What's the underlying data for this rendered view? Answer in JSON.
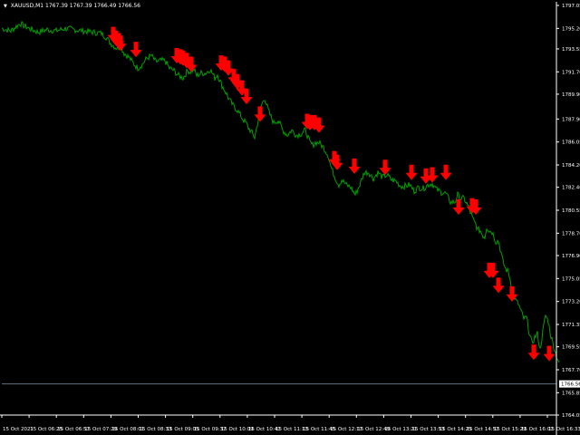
{
  "window": {
    "symbol_label": "XAUUSD,M1",
    "ohlc_text": "1767.39 1767.39 1766.49 1766.56"
  },
  "colors": {
    "background": "#000000",
    "price_line": "#00a000",
    "signal_arrow": "#ff0000",
    "axis": "#ffffff",
    "bid_line": "#607080",
    "price_tag_bg": "#ffffff",
    "price_tag_fg": "#000000"
  },
  "chart_data": {
    "type": "line",
    "symbol": "XAUUSD",
    "timeframe": "M1",
    "current_price": 1766.56,
    "ylim": [
      1764.05,
      1797.05
    ],
    "y_ticks": [
      "1797.05",
      "1795.20",
      "1793.55",
      "1791.70",
      "1789.90",
      "1787.90",
      "1786.05",
      "1784.20",
      "1782.40",
      "1780.55",
      "1778.70",
      "1776.90",
      "1775.05",
      "1773.20",
      "1771.35",
      "1769.55",
      "1767.70",
      "1765.85",
      "1764.05"
    ],
    "x_ticks": [
      "15 Oct 2021",
      "15 Oct 06:25",
      "15 Oct 06:57",
      "15 Oct 07:29",
      "15 Oct 08:01",
      "15 Oct 08:33",
      "15 Oct 09:05",
      "15 Oct 09:37",
      "15 Oct 10:09",
      "15 Oct 10:41",
      "15 Oct 11:13",
      "15 Oct 11:45",
      "15 Oct 12:17",
      "15 Oct 12:49",
      "15 Oct 13:21",
      "15 Oct 13:53",
      "15 Oct 14:25",
      "15 Oct 14:57",
      "15 Oct 15:29",
      "15 Oct 16:01",
      "15 Oct 16:33"
    ],
    "series": [
      {
        "x_index": [
          0,
          10,
          20,
          30,
          40,
          50,
          60,
          70,
          80,
          90,
          100,
          110,
          115,
          120,
          125,
          128,
          131,
          135,
          140,
          145,
          150,
          155,
          160,
          165,
          170,
          175,
          180,
          185,
          190,
          195,
          200,
          205,
          208,
          212,
          215,
          220,
          225,
          230,
          235,
          238,
          240,
          243,
          246,
          250,
          255,
          260,
          265,
          270,
          272,
          276,
          279,
          282,
          286,
          290,
          295,
          300,
          305,
          310,
          315,
          320,
          325,
          330,
          335,
          340,
          343,
          346,
          350,
          355,
          360,
          363,
          366,
          369,
          372,
          375,
          380,
          385,
          390,
          395,
          400,
          405,
          410,
          415,
          420,
          425,
          430,
          435,
          440,
          445,
          450,
          455,
          460,
          465,
          470,
          475,
          480,
          485,
          490,
          495,
          500,
          503,
          506,
          510,
          515,
          520,
          523,
          525,
          528,
          531,
          533,
          535,
          538,
          541,
          543,
          545,
          548,
          551,
          553,
          556,
          559,
          562,
          564,
          567,
          570,
          573,
          576,
          579,
          582,
          585,
          588,
          591,
          594,
          597,
          600,
          603,
          606,
          609,
          612,
          615
        ],
        "values": [
          1795.2,
          1795.0,
          1795.6,
          1795.2,
          1794.9,
          1795.1,
          1795.0,
          1795.2,
          1795.1,
          1795.0,
          1794.9,
          1794.8,
          1794.5,
          1794.0,
          1793.7,
          1793.6,
          1793.8,
          1793.2,
          1792.9,
          1792.4,
          1792.0,
          1792.3,
          1792.8,
          1793.0,
          1792.5,
          1792.6,
          1792.6,
          1792.0,
          1791.8,
          1791.4,
          1791.2,
          1791.8,
          1791.7,
          1791.9,
          1791.4,
          1791.6,
          1791.6,
          1791.9,
          1791.2,
          1791.5,
          1791.1,
          1790.6,
          1790.2,
          1789.6,
          1789.0,
          1788.6,
          1788.0,
          1787.5,
          1787.2,
          1786.8,
          1786.4,
          1787.5,
          1788.9,
          1789.6,
          1788.4,
          1787.6,
          1787.8,
          1787.0,
          1786.6,
          1787.0,
          1786.6,
          1786.7,
          1787.0,
          1786.0,
          1785.8,
          1786.0,
          1786.0,
          1785.6,
          1785.0,
          1784.1,
          1783.5,
          1783.0,
          1782.6,
          1783.0,
          1782.6,
          1782.4,
          1781.8,
          1782.6,
          1783.6,
          1783.6,
          1783.1,
          1783.6,
          1783.2,
          1783.4,
          1783.0,
          1782.9,
          1782.5,
          1782.5,
          1782.6,
          1782.1,
          1782.4,
          1782.3,
          1782.6,
          1782.7,
          1782.2,
          1782.0,
          1781.9,
          1781.2,
          1781.2,
          1781.8,
          1781.5,
          1781.5,
          1780.8,
          1779.8,
          1779.4,
          1779.0,
          1778.9,
          1778.5,
          1778.4,
          1779.2,
          1778.9,
          1778.8,
          1778.5,
          1778.0,
          1778.1,
          1777.1,
          1776.4,
          1775.8,
          1775.6,
          1774.6,
          1774.0,
          1773.3,
          1773.0,
          1772.4,
          1771.8,
          1771.9,
          1770.7,
          1769.8,
          1770.3,
          1770.6,
          1769.3,
          1770.8,
          1772.1,
          1771.6,
          1770.4,
          1769.6,
          1768.8,
          1768.3,
          1767.9,
          1768.2,
          1767.0,
          1766.8,
          1765.4,
          1768.9,
          1766.9,
          1768.5,
          1767.2,
          1766.8,
          1767.0,
          1767.1,
          1768.7,
          1769.3,
          1768.4,
          1767.0,
          1767.5,
          1766.6,
          1767.0,
          1770.0,
          1772.9,
          1773.7
        ]
      }
    ],
    "signals": {
      "type": "sell-arrow",
      "x_index": [
        123,
        126,
        129,
        131,
        148,
        193,
        197,
        200,
        204,
        209,
        242,
        246,
        250,
        256,
        260,
        265,
        270,
        285,
        337,
        340,
        345,
        350,
        367,
        370,
        389,
        423,
        452,
        468,
        475,
        490,
        504,
        519,
        523,
        538,
        542,
        548,
        563,
        587,
        604
      ],
      "values": [
        1794.3,
        1794.0,
        1793.8,
        1793.6,
        1793.1,
        1792.6,
        1792.5,
        1792.4,
        1792.2,
        1791.9,
        1792.0,
        1791.9,
        1791.6,
        1790.9,
        1790.5,
        1790.0,
        1789.3,
        1787.9,
        1787.3,
        1787.2,
        1787.2,
        1787.0,
        1784.3,
        1784.0,
        1783.7,
        1783.6,
        1783.2,
        1782.9,
        1783.0,
        1783.2,
        1780.4,
        1780.5,
        1780.4,
        1775.3,
        1775.3,
        1774.1,
        1773.4,
        1768.7,
        1768.6
      ]
    }
  }
}
